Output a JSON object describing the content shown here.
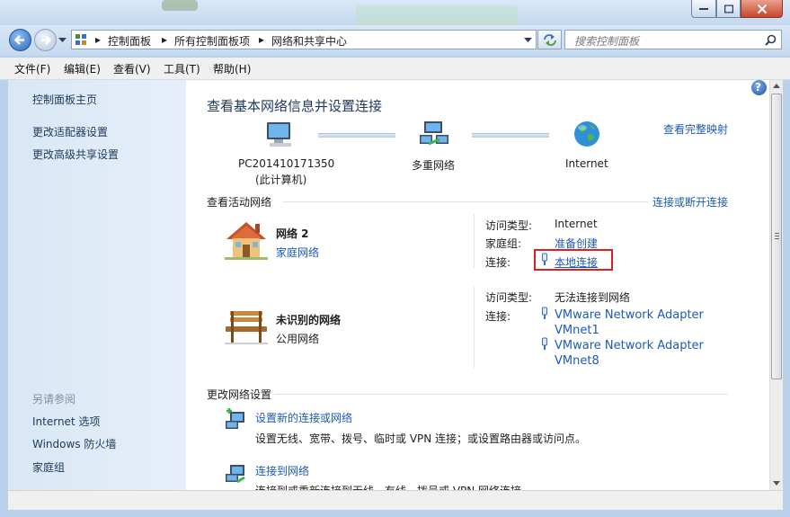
{
  "address": {
    "breadcrumbs": [
      "控制面板",
      "所有控制面板项",
      "网络和共享中心"
    ],
    "search_placeholder": "搜索控制面板"
  },
  "menu": [
    "文件(F)",
    "编辑(E)",
    "查看(V)",
    "工具(T)",
    "帮助(H)"
  ],
  "sidebar": {
    "links": [
      "控制面板主页",
      "更改适配器设置",
      "更改高级共享设置"
    ],
    "see_also_header": "另请参阅",
    "see_also": [
      "Internet 选项",
      "Windows 防火墙",
      "家庭组"
    ]
  },
  "main": {
    "title": "查看基本网络信息并设置连接",
    "full_map_link": "查看完整映射",
    "map": {
      "computer_name": "PC201410171350",
      "computer_sub": "(此计算机)",
      "middle": "多重网络",
      "internet": "Internet"
    },
    "active_header": "查看活动网络",
    "connect_disconnect_link": "连接或断开连接",
    "networks": [
      {
        "name": "网络  2",
        "type": "家庭网络",
        "access_label": "访问类型:",
        "access_value": "Internet",
        "homegroup_label": "家庭组:",
        "homegroup_value": "准备创建",
        "conn_label": "连接:",
        "connections": [
          "本地连接"
        ]
      },
      {
        "name": "未识别的网络",
        "type": "公用网络",
        "access_label": "访问类型:",
        "access_value": "无法连接到网络",
        "conn_label": "连接:",
        "connections": [
          "VMware Network Adapter",
          "VMnet1",
          "VMware Network Adapter",
          "VMnet8"
        ]
      }
    ],
    "change_header": "更改网络设置",
    "tasks": [
      {
        "title": "设置新的连接或网络",
        "desc": "设置无线、宽带、拨号、临时或 VPN 连接；或设置路由器或访问点。"
      },
      {
        "title": "连接到网络",
        "desc": "连接到或重新连接到无线、有线、拨号或 VPN 网络连接。"
      }
    ]
  },
  "colors": {
    "link": "#1e5ab4",
    "title": "#1e395b",
    "highlight_box": "#e02020"
  }
}
